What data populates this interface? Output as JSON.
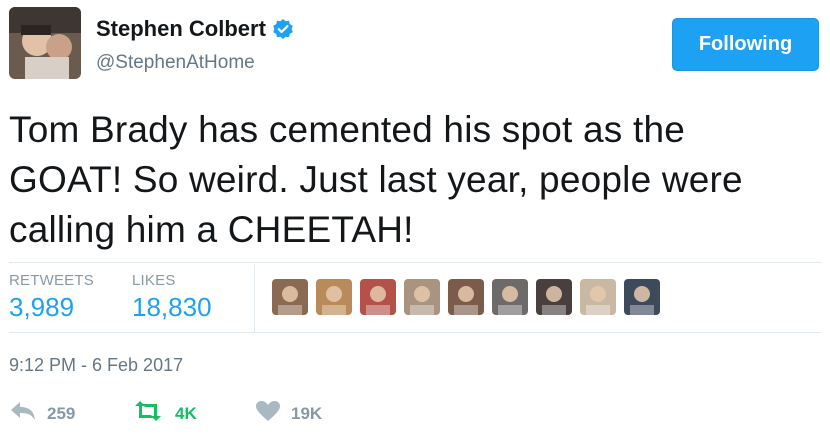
{
  "user": {
    "display_name": "Stephen Colbert",
    "handle": "@StephenAtHome",
    "avatar_icon": "user-avatar",
    "verified_icon": "verified-badge-icon"
  },
  "follow_button": {
    "label": "Following"
  },
  "tweet": {
    "text_lines": [
      "Tom Brady has cemented his spot as the",
      "GOAT! So weird. Just last year, people were",
      "calling him a CHEETAH!"
    ],
    "timestamp": "9:12 PM - 6 Feb 2017"
  },
  "stats": {
    "retweets_label": "RETWEETS",
    "retweets_value": "3,989",
    "likes_label": "LIKES",
    "likes_value": "18,830"
  },
  "likers": [
    {
      "name": "liker-avatar-1",
      "color": "#8a6a52"
    },
    {
      "name": "liker-avatar-2",
      "color": "#b98a5a"
    },
    {
      "name": "liker-avatar-3",
      "color": "#b4524a"
    },
    {
      "name": "liker-avatar-4",
      "color": "#a99480"
    },
    {
      "name": "liker-avatar-5",
      "color": "#7b5c4b"
    },
    {
      "name": "liker-avatar-6",
      "color": "#6e6a6a"
    },
    {
      "name": "liker-avatar-7",
      "color": "#4a3f3f"
    },
    {
      "name": "liker-avatar-8",
      "color": "#c9b8a2"
    },
    {
      "name": "liker-avatar-9",
      "color": "#3c4a5c"
    }
  ],
  "actions": {
    "reply": {
      "icon": "reply-icon",
      "count": "259"
    },
    "retweet": {
      "icon": "retweet-icon",
      "count": "4K"
    },
    "like": {
      "icon": "heart-icon",
      "count": "19K"
    }
  },
  "colors": {
    "accent": "#1da1f2",
    "retweet_green": "#17bf63",
    "muted": "#8899a6"
  }
}
